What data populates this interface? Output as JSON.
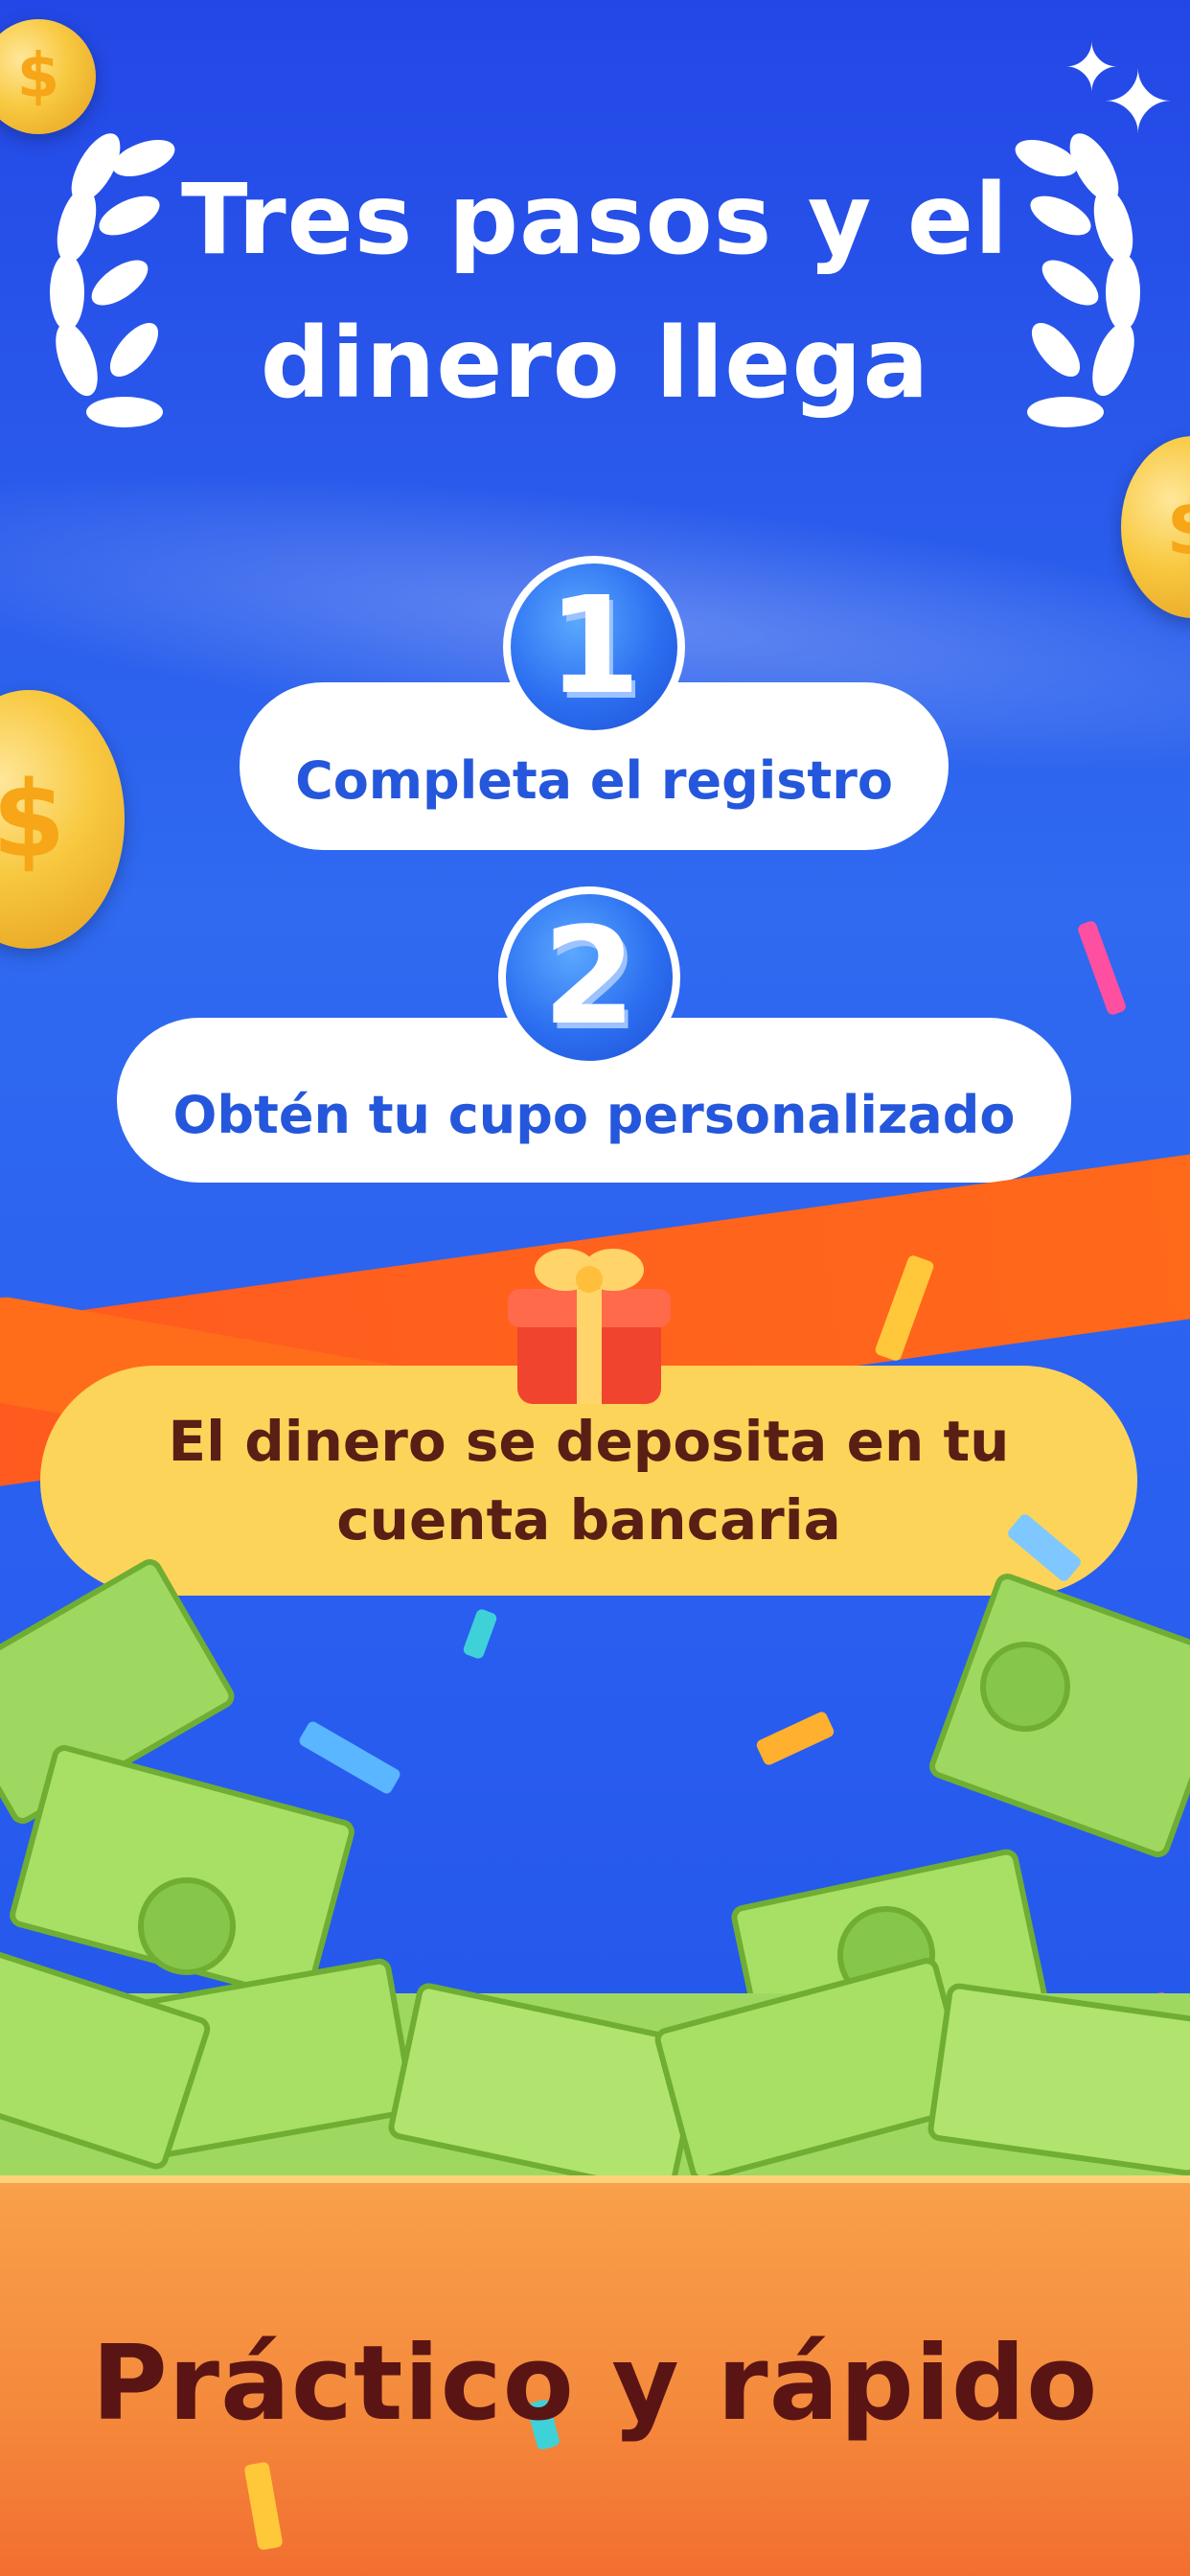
{
  "header": {
    "title_line1": "Tres pasos y el",
    "title_line2": "dinero llega"
  },
  "steps": [
    {
      "number": "1",
      "label": "Completa el registro"
    },
    {
      "number": "2",
      "label": "Obtén tu cupo personalizado"
    }
  ],
  "final_step": {
    "line1": "El dinero se deposita en tu",
    "line2": "cuenta bancaria"
  },
  "footer": {
    "slogan": "Práctico y rápido"
  },
  "decor": {
    "coin_symbol": "$",
    "icons": [
      "laurel-left-icon",
      "laurel-right-icon",
      "sparkle-icon",
      "gift-icon",
      "coin-icon",
      "cash-icon"
    ]
  },
  "colors": {
    "background": "#2f6af0",
    "step_text": "#2457db",
    "final_pill": "#fdd45a",
    "final_text": "#5a1e14",
    "ribbon": "#ff5a1f",
    "footer": "#f48a3c",
    "slogan": "#5a1414"
  }
}
